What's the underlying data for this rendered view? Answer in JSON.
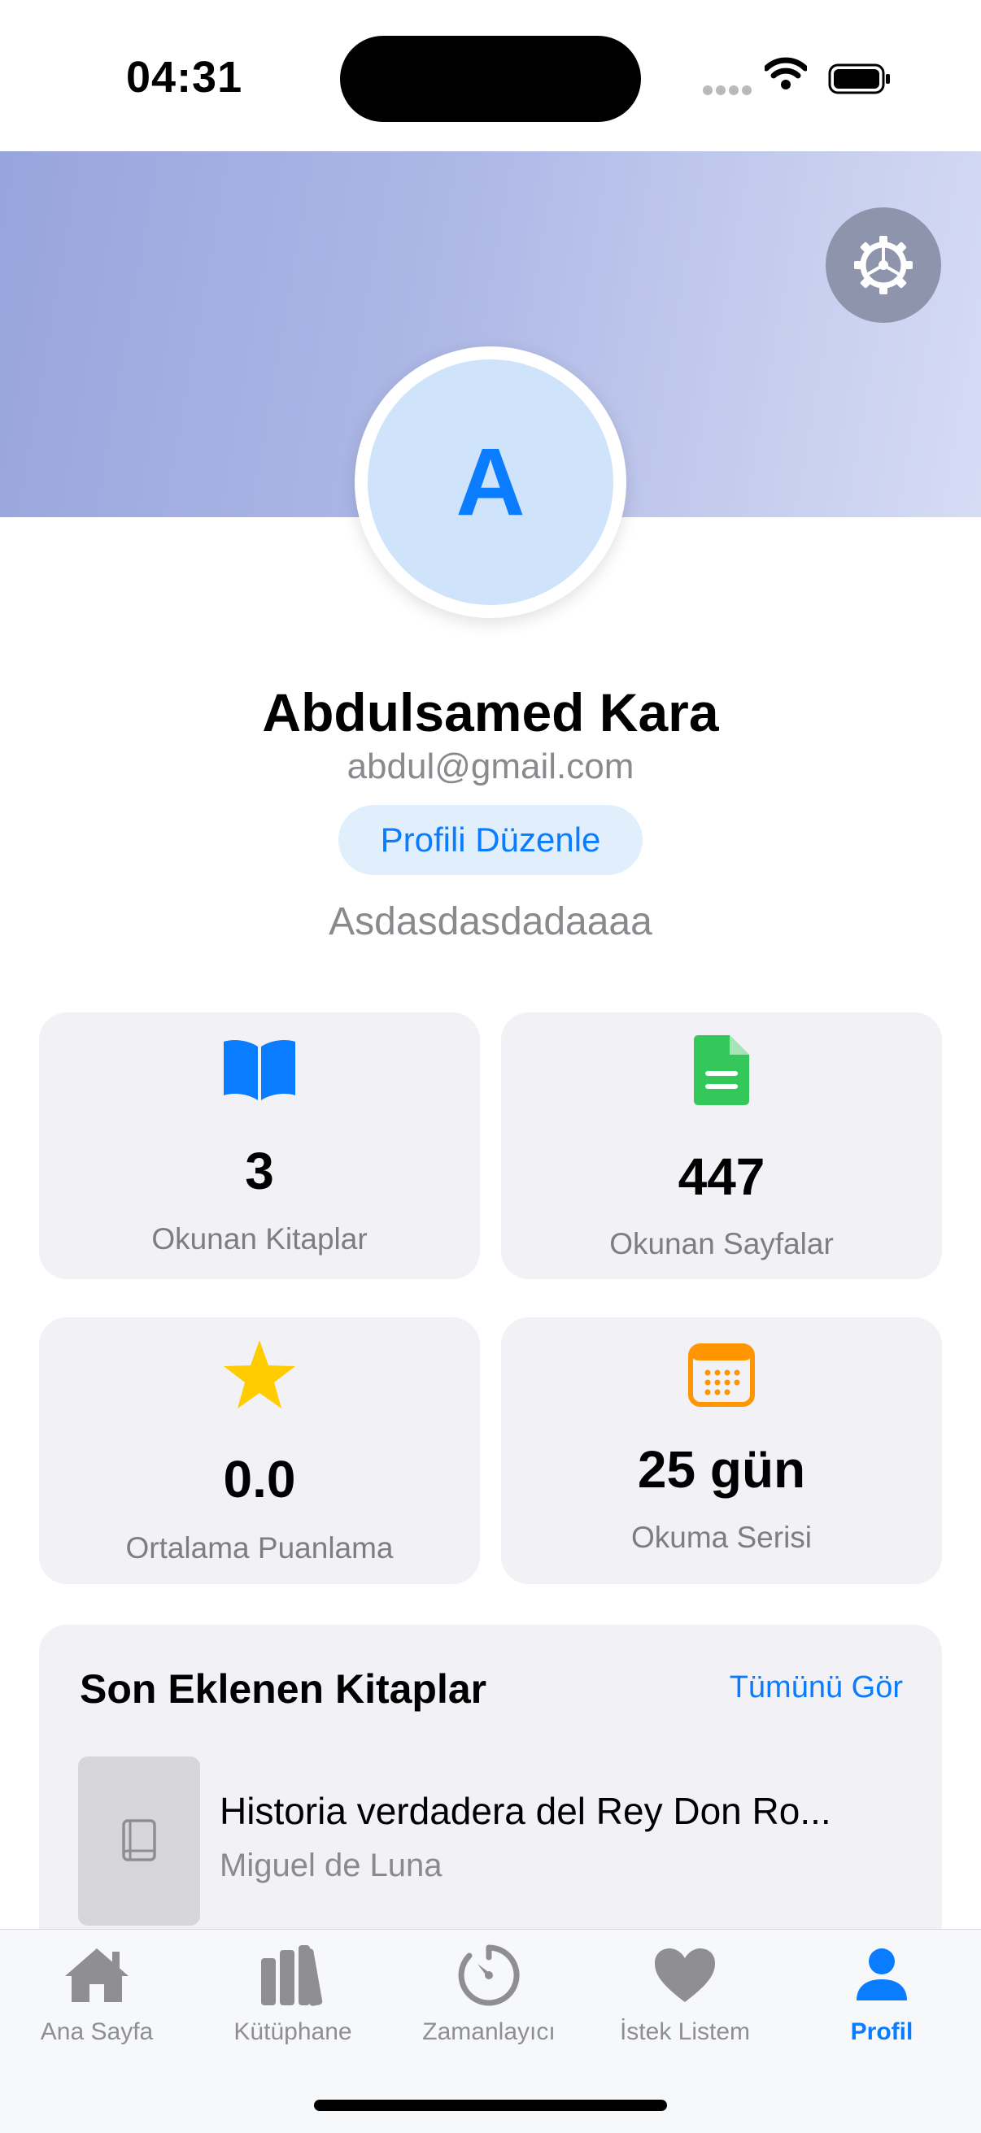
{
  "status_bar": {
    "time": "04:31"
  },
  "profile": {
    "avatar_letter": "A",
    "name": "Abdulsamed Kara",
    "email": "abdul@gmail.com",
    "edit_button": "Profili Düzenle",
    "bio": "Asdasdasdadaaaa"
  },
  "stats": [
    {
      "icon": "open-book-icon",
      "value": "3",
      "label": "Okunan Kitaplar",
      "color": "#0a7cff"
    },
    {
      "icon": "document-icon",
      "value": "447",
      "label": "Okunan Sayfalar",
      "color": "#34c759"
    },
    {
      "icon": "star-icon",
      "value": "0.0",
      "label": "Ortalama Puanlama",
      "color": "#ffcc00"
    },
    {
      "icon": "calendar-icon",
      "value": "25 gün",
      "label": "Okuma Serisi",
      "color": "#ff9500"
    }
  ],
  "recent_books": {
    "title": "Son Eklenen Kitaplar",
    "see_all": "Tümünü Gör",
    "items": [
      {
        "title": "Historia verdadera del Rey Don Ro...",
        "author": "Miguel de Luna"
      }
    ]
  },
  "tab_bar": {
    "tabs": [
      {
        "icon": "house-icon",
        "label": "Ana Sayfa",
        "active": false
      },
      {
        "icon": "books-icon",
        "label": "Kütüphane",
        "active": false
      },
      {
        "icon": "timer-icon",
        "label": "Zamanlayıcı",
        "active": false
      },
      {
        "icon": "heart-icon",
        "label": "İstek Listem",
        "active": false
      },
      {
        "icon": "person-icon",
        "label": "Profil",
        "active": true
      }
    ]
  },
  "colors": {
    "accent": "#0a7cff",
    "inactive": "#8e8e93"
  }
}
